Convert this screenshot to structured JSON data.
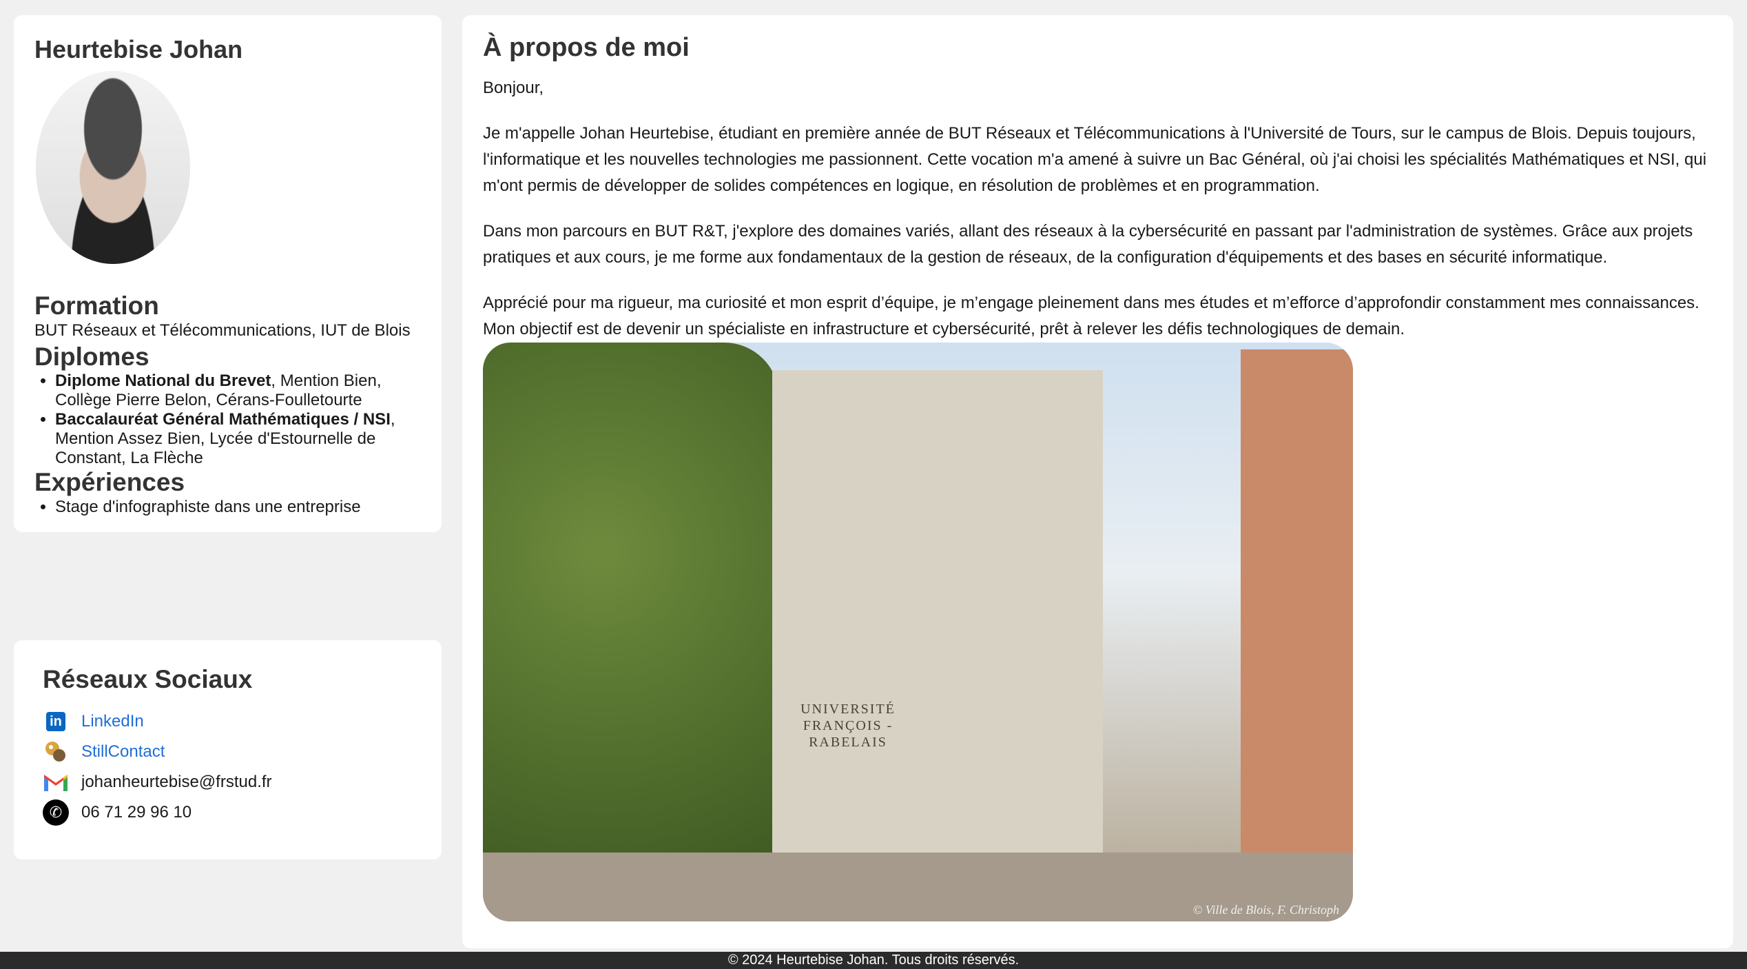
{
  "profile": {
    "name": "Heurtebise Johan",
    "formation_title": "Formation",
    "formation_text": "BUT Réseaux et Télécommunications, IUT de Blois",
    "diplomes_title": "Diplomes",
    "diplomes": [
      {
        "bold": "Diplome National du Brevet",
        "rest": ", Mention Bien, Collège Pierre Belon, Cérans-Foulletourte"
      },
      {
        "bold": "Baccalauréat Général Mathématiques / NSI",
        "rest": ", Mention Assez Bien, Lycée d'Estournelle de Constant, La Flèche"
      }
    ],
    "experiences_title": "Expériences",
    "experiences": [
      "Stage d'infographiste dans une entreprise"
    ]
  },
  "social": {
    "title": "Réseaux Sociaux",
    "items": [
      {
        "icon": "linkedin-icon",
        "label": "LinkedIn"
      },
      {
        "icon": "stillcontact-icon",
        "label": "StillContact"
      },
      {
        "icon": "gmail-icon",
        "label": "johanheurtebise@frstud.fr"
      },
      {
        "icon": "phone-icon",
        "label": "06 71 29 96 10"
      }
    ]
  },
  "about": {
    "title": "À propos de moi",
    "paragraphs": [
      "Bonjour,",
      "Je m'appelle Johan Heurtebise, étudiant en première année de BUT Réseaux et Télécommunications à l'Université de Tours, sur le campus de Blois. Depuis toujours, l'informatique et les nouvelles technologies me passionnent. Cette vocation m'a amené à suivre un Bac Général, où j'ai choisi les spécialités Mathématiques et NSI, qui m'ont permis de développer de solides compétences en logique, en résolution de problèmes et en programmation.",
      "Dans mon parcours en BUT R&T, j'explore des domaines variés, allant des réseaux à la cybersécurité en passant par l'administration de systèmes. Grâce aux projets pratiques et aux cours, je me forme aux fondamentaux de la gestion de réseaux, de la configuration d'équipements et des bases en sécurité informatique.",
      "Apprécié pour ma rigueur, ma curiosité et mon esprit d’équipe, je m’engage pleinement dans mes études et m’efforce d’approfondir constamment mes connaissances. Mon objectif est de devenir un spécialiste en infrastructure et cybersécurité, prêt à relever les défis technologiques de demain."
    ],
    "photo_sign_line1": "UNIVERSITÉ",
    "photo_sign_line2": "FRANÇOIS - RABELAIS",
    "photo_credit": "© Ville de Blois, F. Christoph"
  },
  "footer": {
    "text": "© 2024 Heurtebise Johan. Tous droits réservés."
  },
  "colors": {
    "link": "#1f6fd6",
    "background": "#f0f0f0",
    "card": "#ffffff",
    "footer": "#2b2b2b"
  }
}
